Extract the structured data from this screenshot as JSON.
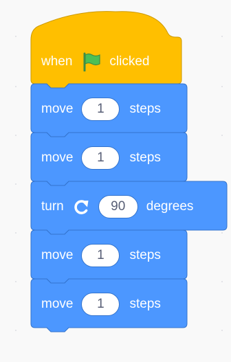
{
  "colors": {
    "canvas_background": "#f9f9f9",
    "events_block_fill": "#ffbf00",
    "events_block_border": "#cc9900",
    "motion_block_fill": "#4c97ff",
    "motion_block_border": "#3373cc",
    "block_text": "#ffffff",
    "input_text": "#575e75",
    "flag_green": "#4cbf56"
  },
  "script": {
    "hat_block": {
      "icon": "green-flag-icon",
      "text_before": "when",
      "text_after": "clicked"
    },
    "blocks": [
      {
        "type": "move",
        "text_before": "move",
        "input_value": "1",
        "text_after": "steps"
      },
      {
        "type": "move",
        "text_before": "move",
        "input_value": "1",
        "text_after": "steps"
      },
      {
        "type": "turn",
        "text_before": "turn",
        "icon": "rotate-clockwise-icon",
        "input_value": "90",
        "text_after": "degrees"
      },
      {
        "type": "move",
        "text_before": "move",
        "input_value": "1",
        "text_after": "steps"
      },
      {
        "type": "move",
        "text_before": "move",
        "input_value": "1",
        "text_after": "steps"
      }
    ]
  }
}
